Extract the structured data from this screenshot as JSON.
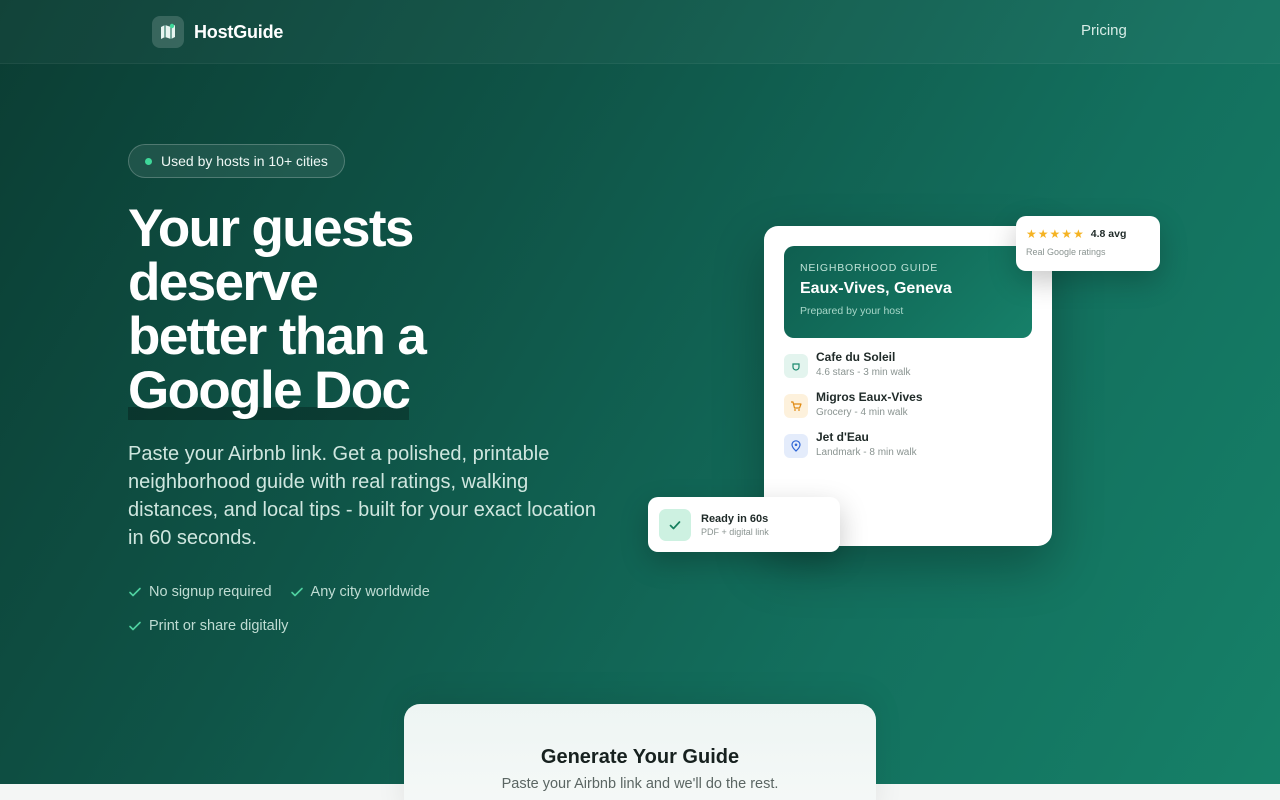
{
  "brand": {
    "name": "HostGuide",
    "icon": "map-icon"
  },
  "nav": {
    "pricing": "Pricing"
  },
  "badge": {
    "text": "Used by hosts in 10+ cities"
  },
  "hero": {
    "title_lines": [
      "Your guests",
      "deserve",
      "better than a",
      "Google Doc"
    ],
    "subtitle": "Paste your Airbnb link. Get a polished, printable neighborhood guide with real ratings, walking distances, and local tips - built for your exact location in 60 seconds."
  },
  "checks": [
    "No signup required",
    "Any city worldwide",
    "Print or share digitally"
  ],
  "preview": {
    "kicker": "NEIGHBORHOOD GUIDE",
    "title": "Eaux-Vives, Geneva",
    "note": "Prepared by your host",
    "places": [
      {
        "name": "Cafe du Soleil",
        "meta": "4.6 stars - 3 min walk",
        "icon": "cup-icon"
      },
      {
        "name": "Migros Eaux-Vives",
        "meta": "Grocery - 4 min walk",
        "icon": "cart-icon"
      },
      {
        "name": "Jet d'Eau",
        "meta": "Landmark - 8 min walk",
        "icon": "pin-icon"
      }
    ]
  },
  "rating_card": {
    "stars": "★★★★★",
    "avg": "4.8 avg",
    "note": "Real Google ratings"
  },
  "ready_card": {
    "title": "Ready in 60s",
    "note": "PDF + digital link"
  },
  "generate": {
    "title": "Generate Your Guide",
    "subtitle": "Paste your Airbnb link and we'll do the rest."
  },
  "colors": {
    "accent": "#168069",
    "star": "#f5b323",
    "success_dot": "#3fd89a"
  }
}
